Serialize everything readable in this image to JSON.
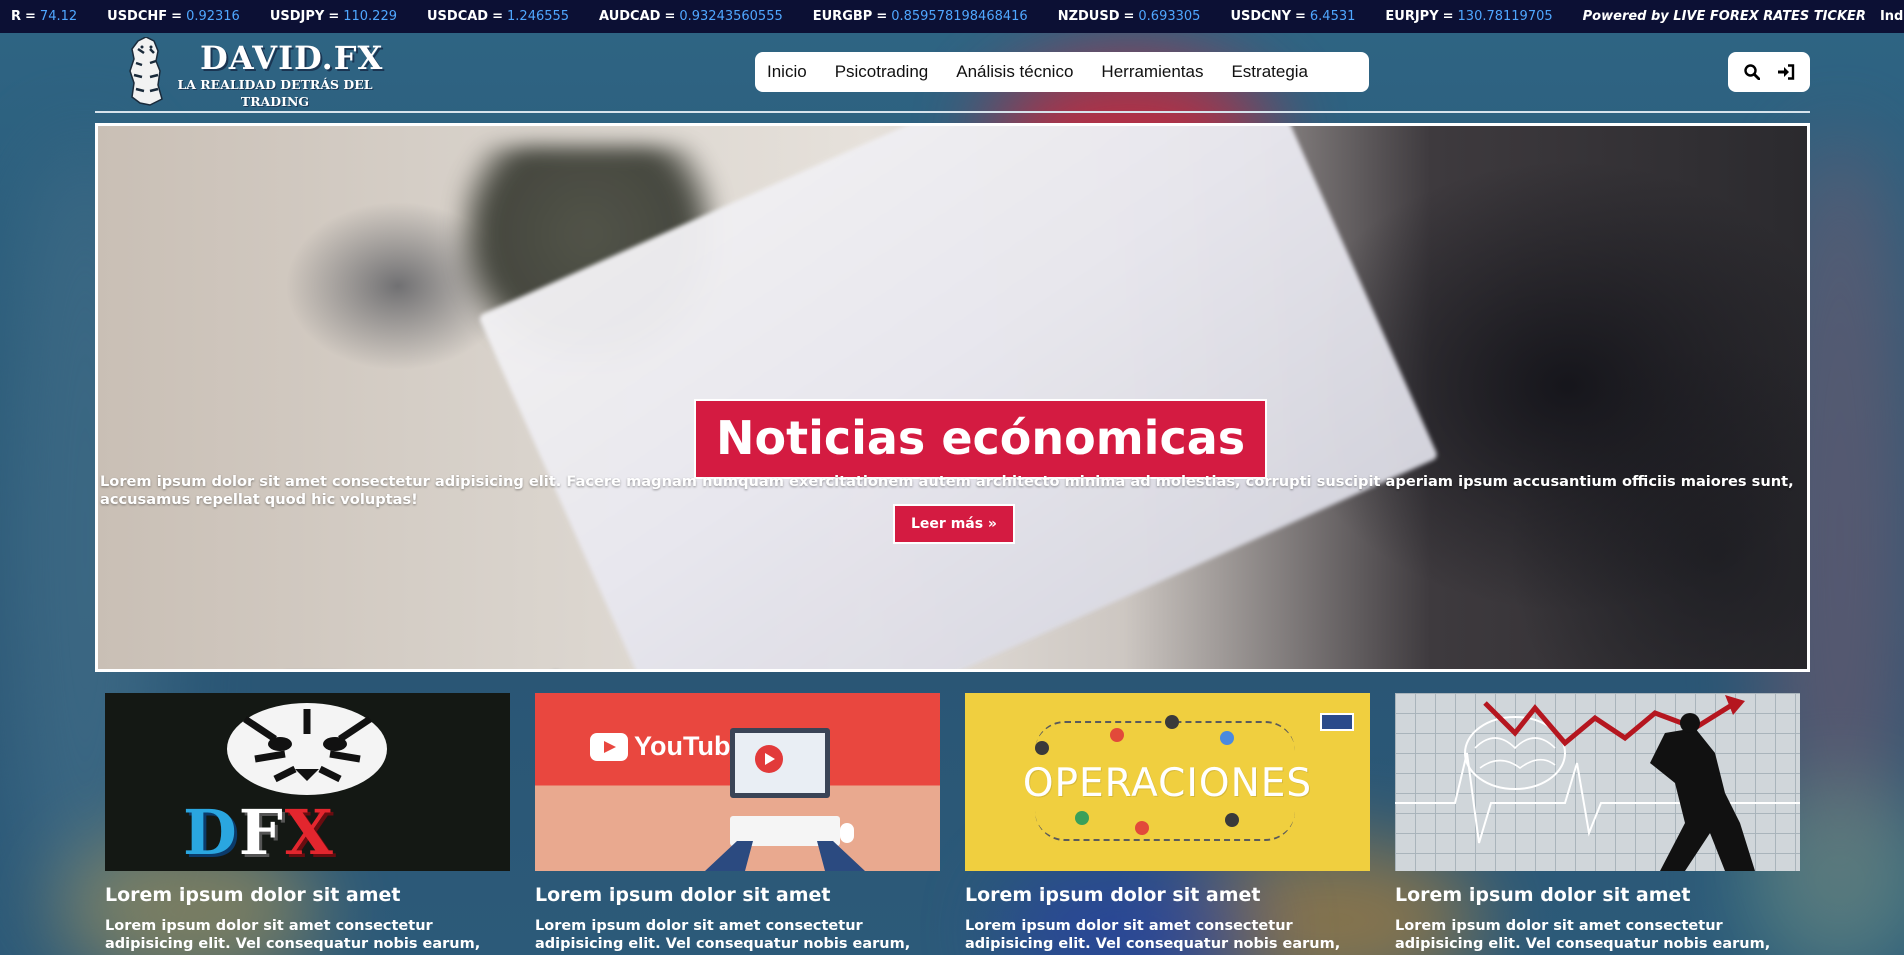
{
  "ticker": {
    "items": [
      {
        "pair": "R",
        "value": "74.12"
      },
      {
        "pair": "USDCHF",
        "value": "0.92316"
      },
      {
        "pair": "USDJPY",
        "value": "110.229"
      },
      {
        "pair": "USDCAD",
        "value": "1.246555"
      },
      {
        "pair": "AUDCAD",
        "value": "0.93243560555"
      },
      {
        "pair": "EURGBP",
        "value": "0.859578198468416"
      },
      {
        "pair": "NZDUSD",
        "value": "0.693305"
      },
      {
        "pair": "USDCNY",
        "value": "6.4531"
      },
      {
        "pair": "EURJPY",
        "value": "130.78119705"
      }
    ],
    "eq": "=",
    "powered": "Powered by LIVE FOREX RATES TICKER",
    "trailing": "Indicat",
    "value_color": "#4fa7ff"
  },
  "header": {
    "logo_title": "DAVID.FX",
    "logo_subtitle": "LA REALIDAD DETRÁS DEL TRADING",
    "nav": [
      "Inicio",
      "Psicotrading",
      "Análisis técnico",
      "Herramientas",
      "Estrategia"
    ],
    "icons": [
      "search-icon",
      "sign-in-icon"
    ]
  },
  "hero": {
    "title": "Noticias ecónomicas",
    "description": "Lorem ipsum dolor sit amet consectetur adipisicing elit. Facere magnam numquam exercitationem autem architecto minima ad molestias, corrupti suscipit aperiam ipsum accusantium officiis maiores sunt, accusamus repellat quod hic voluptas!",
    "button": "Leer más »",
    "accent": "#d41b41"
  },
  "cards": [
    {
      "image": "DFX",
      "title": "Lorem ipsum dolor sit amet",
      "text": "Lorem ipsum dolor sit amet consectetur adipisicing elit. Vel consequatur nobis earum, quasi"
    },
    {
      "image": "YouTube",
      "title": "Lorem ipsum dolor sit amet",
      "text": "Lorem ipsum dolor sit amet consectetur adipisicing elit. Vel consequatur nobis earum, quasi"
    },
    {
      "image": "OPERACIONES",
      "title": "Lorem ipsum dolor sit amet",
      "text": "Lorem ipsum dolor sit amet consectetur adipisicing elit. Vel consequatur nobis earum, quasi"
    },
    {
      "image": "brain-chart",
      "title": "Lorem ipsum dolor sit amet",
      "text": "Lorem ipsum dolor sit amet consectetur adipisicing elit. Vel consequatur nobis earum, quasi"
    }
  ]
}
